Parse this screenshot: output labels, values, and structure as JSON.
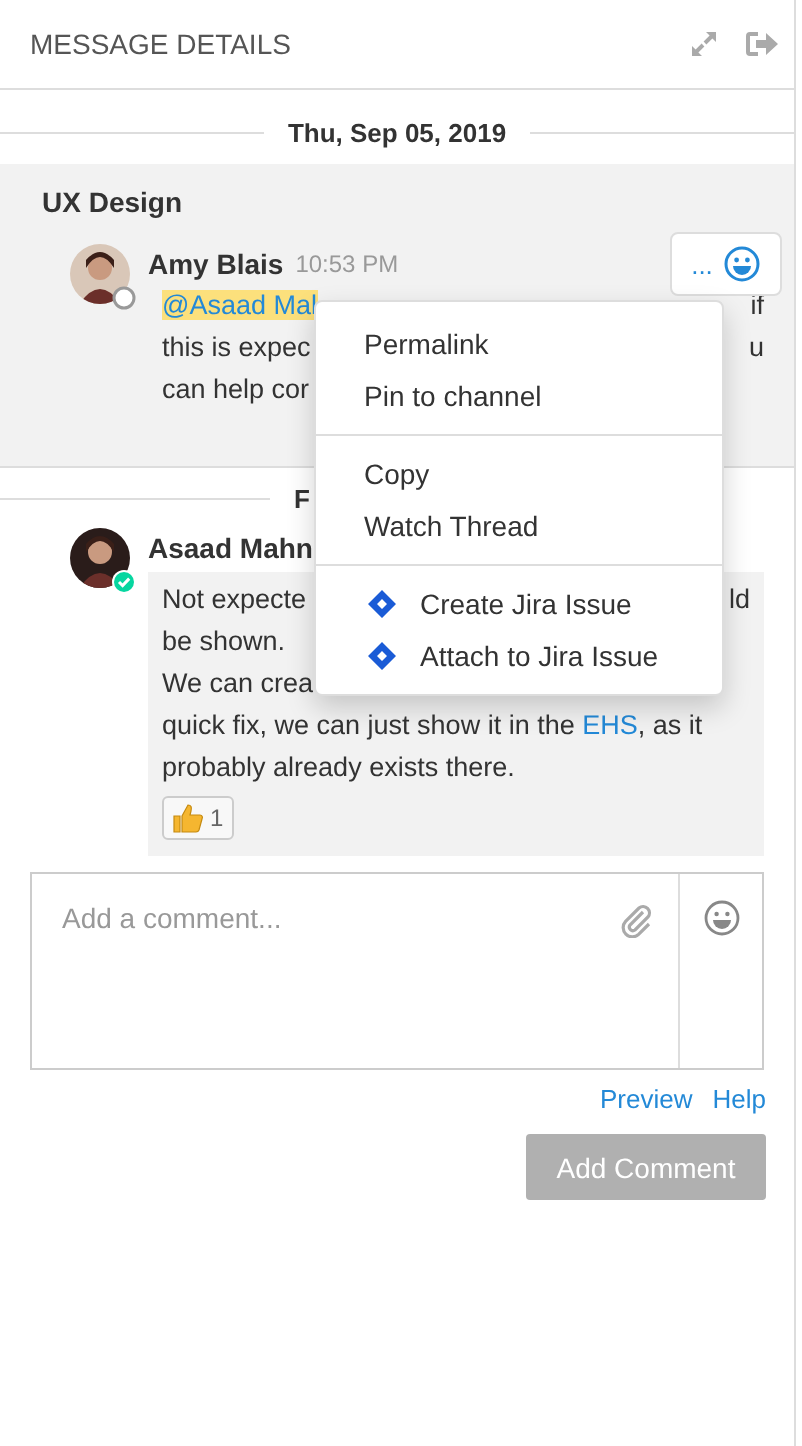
{
  "header": {
    "title": "MESSAGE DETAILS"
  },
  "date_separator": {
    "label": "Thu, Sep 05, 2019"
  },
  "thread": {
    "channel": "UX Design",
    "post": {
      "author": "Amy Blais",
      "time": "10:53 PM",
      "online": false,
      "actions": {
        "more": "..."
      },
      "lines": [
        {
          "left": [
            {
              "kind": "mention",
              "text": "@Asaad Mal"
            }
          ],
          "right": "if"
        },
        {
          "left": [
            {
              "kind": "text",
              "text": "this is expec"
            }
          ],
          "right": "u"
        },
        {
          "left": [
            {
              "kind": "text",
              "text": "can help cor"
            }
          ]
        }
      ]
    }
  },
  "next_separator": {
    "label": "F"
  },
  "reply": {
    "author": "Asaad Mahn",
    "online": true,
    "lines": [
      {
        "left": [
          {
            "kind": "text",
            "text": "Not expecte"
          }
        ],
        "right": "ld"
      },
      {
        "left": [
          {
            "kind": "text",
            "text": "be shown."
          }
        ]
      },
      {
        "left": [
          {
            "kind": "text",
            "text": "We can crea"
          }
        ]
      },
      {
        "left": [
          {
            "kind": "text",
            "text": "quick fix, we can just show it in the "
          },
          {
            "kind": "link",
            "text": "EHS"
          },
          {
            "kind": "text",
            "text": ", as it"
          }
        ]
      },
      {
        "left": [
          {
            "kind": "text",
            "text": "probably already exists there."
          }
        ]
      }
    ],
    "reactions": [
      {
        "count": "1"
      }
    ]
  },
  "comment_form": {
    "placeholder": "Add a comment...",
    "links": [
      "Preview",
      "Help"
    ],
    "submit": {
      "label": "Add Comment",
      "disabled": true
    }
  },
  "menu": {
    "groups": [
      [
        {
          "kind": "plain",
          "label": "Permalink"
        },
        {
          "kind": "plain",
          "label": "Pin to channel"
        }
      ],
      [
        {
          "kind": "plain",
          "label": "Copy"
        },
        {
          "kind": "plain",
          "label": "Watch Thread"
        }
      ],
      [
        {
          "kind": "jira",
          "label": "Create Jira Issue"
        },
        {
          "kind": "jira",
          "label": "Attach to Jira Issue"
        }
      ]
    ]
  }
}
